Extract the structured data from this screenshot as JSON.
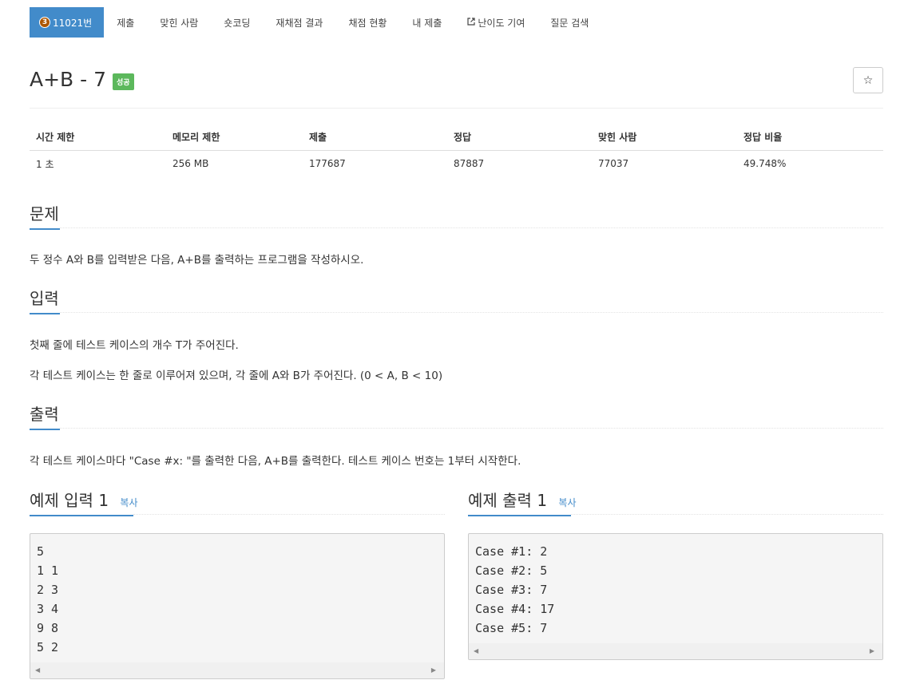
{
  "nav": {
    "tier": "3",
    "problem_tab": "11021번",
    "tabs": [
      "제출",
      "맞힌 사람",
      "숏코딩",
      "재채점 결과",
      "채점 현황",
      "내 제출",
      "난이도 기여",
      "질문 검색"
    ]
  },
  "problem": {
    "title": "A+B - 7",
    "badge": "성공",
    "star": "☆"
  },
  "info": {
    "headers": [
      "시간 제한",
      "메모리 제한",
      "제출",
      "정답",
      "맞힌 사람",
      "정답 비율"
    ],
    "values": [
      "1 초",
      "256 MB",
      "177687",
      "87887",
      "77037",
      "49.748%"
    ]
  },
  "sections": {
    "problem_head": "문제",
    "problem_text": "두 정수 A와 B를 입력받은 다음, A+B를 출력하는 프로그램을 작성하시오.",
    "input_head": "입력",
    "input_text_1": "첫째 줄에 테스트 케이스의 개수 T가 주어진다.",
    "input_text_2": "각 테스트 케이스는 한 줄로 이루어져 있으며, 각 줄에 A와 B가 주어진다. (0 < A, B < 10)",
    "output_head": "출력",
    "output_text": "각 테스트 케이스마다 \"Case #x: \"를 출력한 다음, A+B를 출력한다. 테스트 케이스 번호는 1부터 시작한다."
  },
  "samples": {
    "input_head": "예제 입력 1",
    "output_head": "예제 출력 1",
    "copy_label": "복사",
    "input_data": "5\n1 1\n2 3\n3 4\n9 8\n5 2",
    "output_data": "Case #1: 2\nCase #2: 5\nCase #3: 7\nCase #4: 17\nCase #5: 7"
  }
}
